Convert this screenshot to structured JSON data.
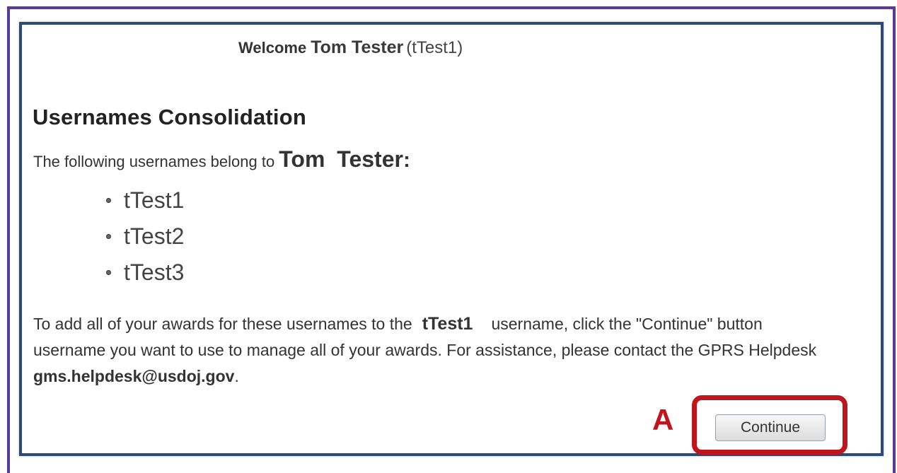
{
  "welcome": {
    "label": "Welcome",
    "name": "Tom Tester",
    "username": "(tTest1)"
  },
  "title": "Usernames Consolidation",
  "intro": {
    "text": "The following usernames belong to",
    "name": "Tom Tester",
    "colon": ":"
  },
  "usernames": [
    "tTest1",
    "tTest2",
    "tTest3"
  ],
  "instructions": {
    "line1_before": "To add all of your awards for these usernames to the",
    "target_username": "tTest1",
    "line1_after": "username, click the \"Continue\" button",
    "line2": "username you want to use to manage all of your awards. For assistance, please contact the GPRS Helpdesk",
    "email": "gms.helpdesk@usdoj.gov",
    "period": "."
  },
  "continue_label": "Continue",
  "callout_label": "A",
  "colors": {
    "outer_frame": "#5a3a96",
    "inner_border": "#2c4a78",
    "callout_red": "#c0151c"
  }
}
